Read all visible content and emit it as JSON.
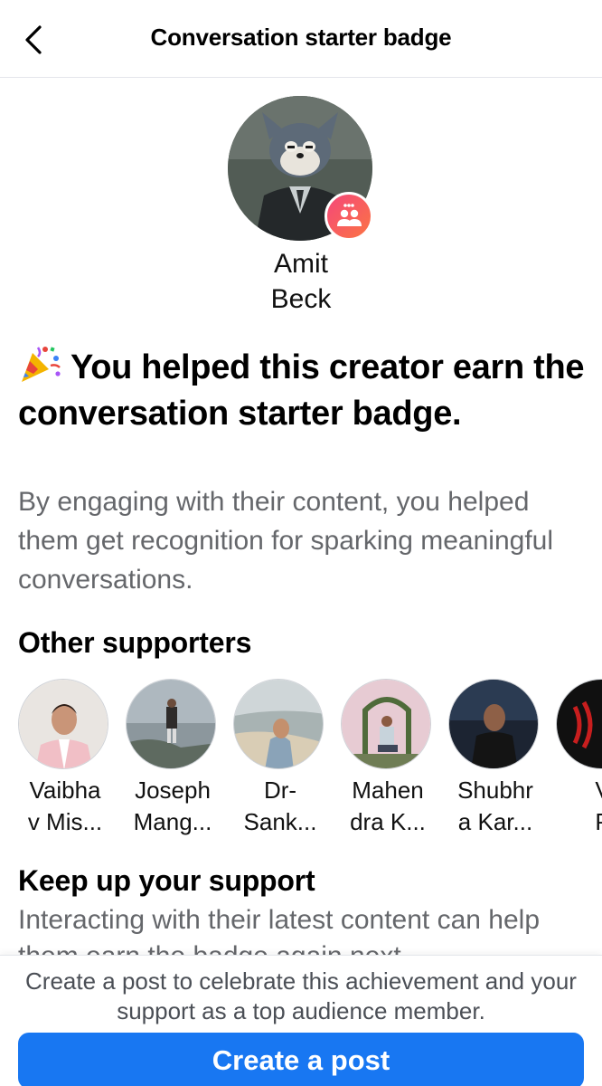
{
  "header": {
    "title": "Conversation starter badge",
    "back_icon": "chevron-left-icon"
  },
  "creator": {
    "name_line1": "Amit",
    "name_line2": "Beck",
    "badge_icon": "people-chat-icon",
    "badge_gradient": [
      "#f5477a",
      "#fb7443"
    ]
  },
  "headline": {
    "emoji": "party-popper-icon",
    "text": "You helped this creator earn the conversation starter badge."
  },
  "description": "By engaging with their content, you helped them get recognition for sparking meaningful conversations.",
  "supporters": {
    "title": "Other supporters",
    "items": [
      {
        "name_line1": "Vaibha",
        "name_line2": "v Mis..."
      },
      {
        "name_line1": "Joseph",
        "name_line2": "Mang..."
      },
      {
        "name_line1": "Dr-",
        "name_line2": "Sank..."
      },
      {
        "name_line1": "Mahen",
        "name_line2": "dra K..."
      },
      {
        "name_line1": "Shubhr",
        "name_line2": "a Kar..."
      },
      {
        "name_line1": "V",
        "name_line2": "P"
      }
    ]
  },
  "keep_support": {
    "title": "Keep up your support",
    "text": "Interacting with their latest content can help them earn the badge again next"
  },
  "footer": {
    "note": "Create a post to celebrate this achievement and your support as a top audience member.",
    "button_label": "Create a post"
  },
  "colors": {
    "accent": "#1877f2",
    "secondary_text": "#65676b"
  }
}
